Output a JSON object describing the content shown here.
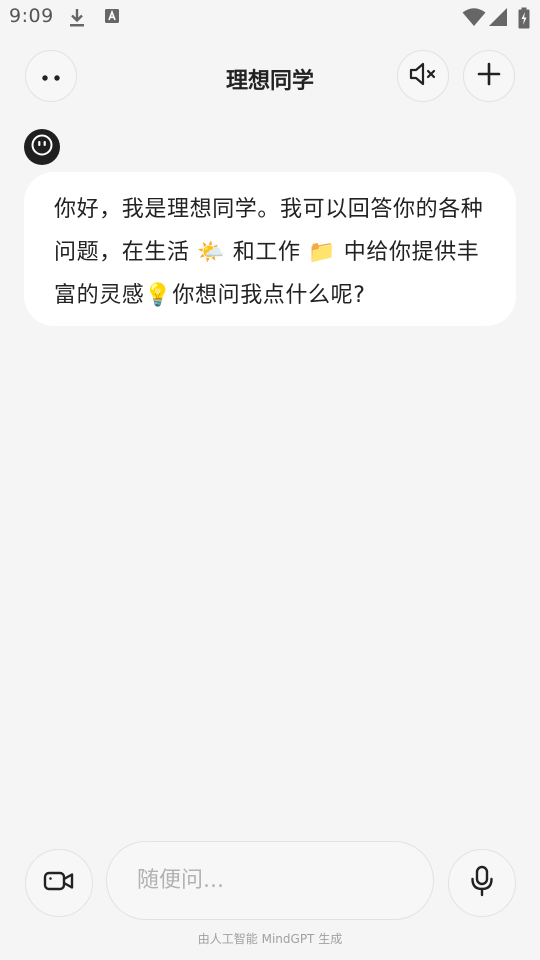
{
  "status_bar": {
    "time": "9:09",
    "icons": [
      "download-icon",
      "a-notification-icon",
      "wifi-icon",
      "signal-icon",
      "battery-charging-icon"
    ]
  },
  "header": {
    "title": "理想同学",
    "left_button_icon": "more-dots-icon",
    "mute_button_icon": "speaker-muted-icon",
    "add_button_icon": "plus-icon"
  },
  "conversation": {
    "avatar_icon": "bot-face-icon",
    "messages": [
      {
        "sender": "bot",
        "segments": [
          {
            "type": "text",
            "value": "你好，我是理想同学。我可以回答你的各种问题，在生活 "
          },
          {
            "type": "emoji",
            "value": "🌤️"
          },
          {
            "type": "text",
            "value": " 和工作 "
          },
          {
            "type": "emoji",
            "value": "📁"
          },
          {
            "type": "text",
            "value": " 中给你提供丰富的灵感"
          },
          {
            "type": "emoji",
            "value": "💡"
          },
          {
            "type": "text",
            "value": "你想问我点什么呢?"
          }
        ]
      }
    ]
  },
  "input": {
    "placeholder": "随便问...",
    "value": "",
    "video_button_icon": "video-camera-icon",
    "mic_button_icon": "microphone-icon"
  },
  "footer": {
    "note": "由人工智能 MindGPT 生成"
  },
  "colors": {
    "background": "#f5f5f5",
    "bubble": "#ffffff",
    "text": "#222222",
    "placeholder": "#b2b2b2",
    "button_border": "#e2e2e2"
  }
}
